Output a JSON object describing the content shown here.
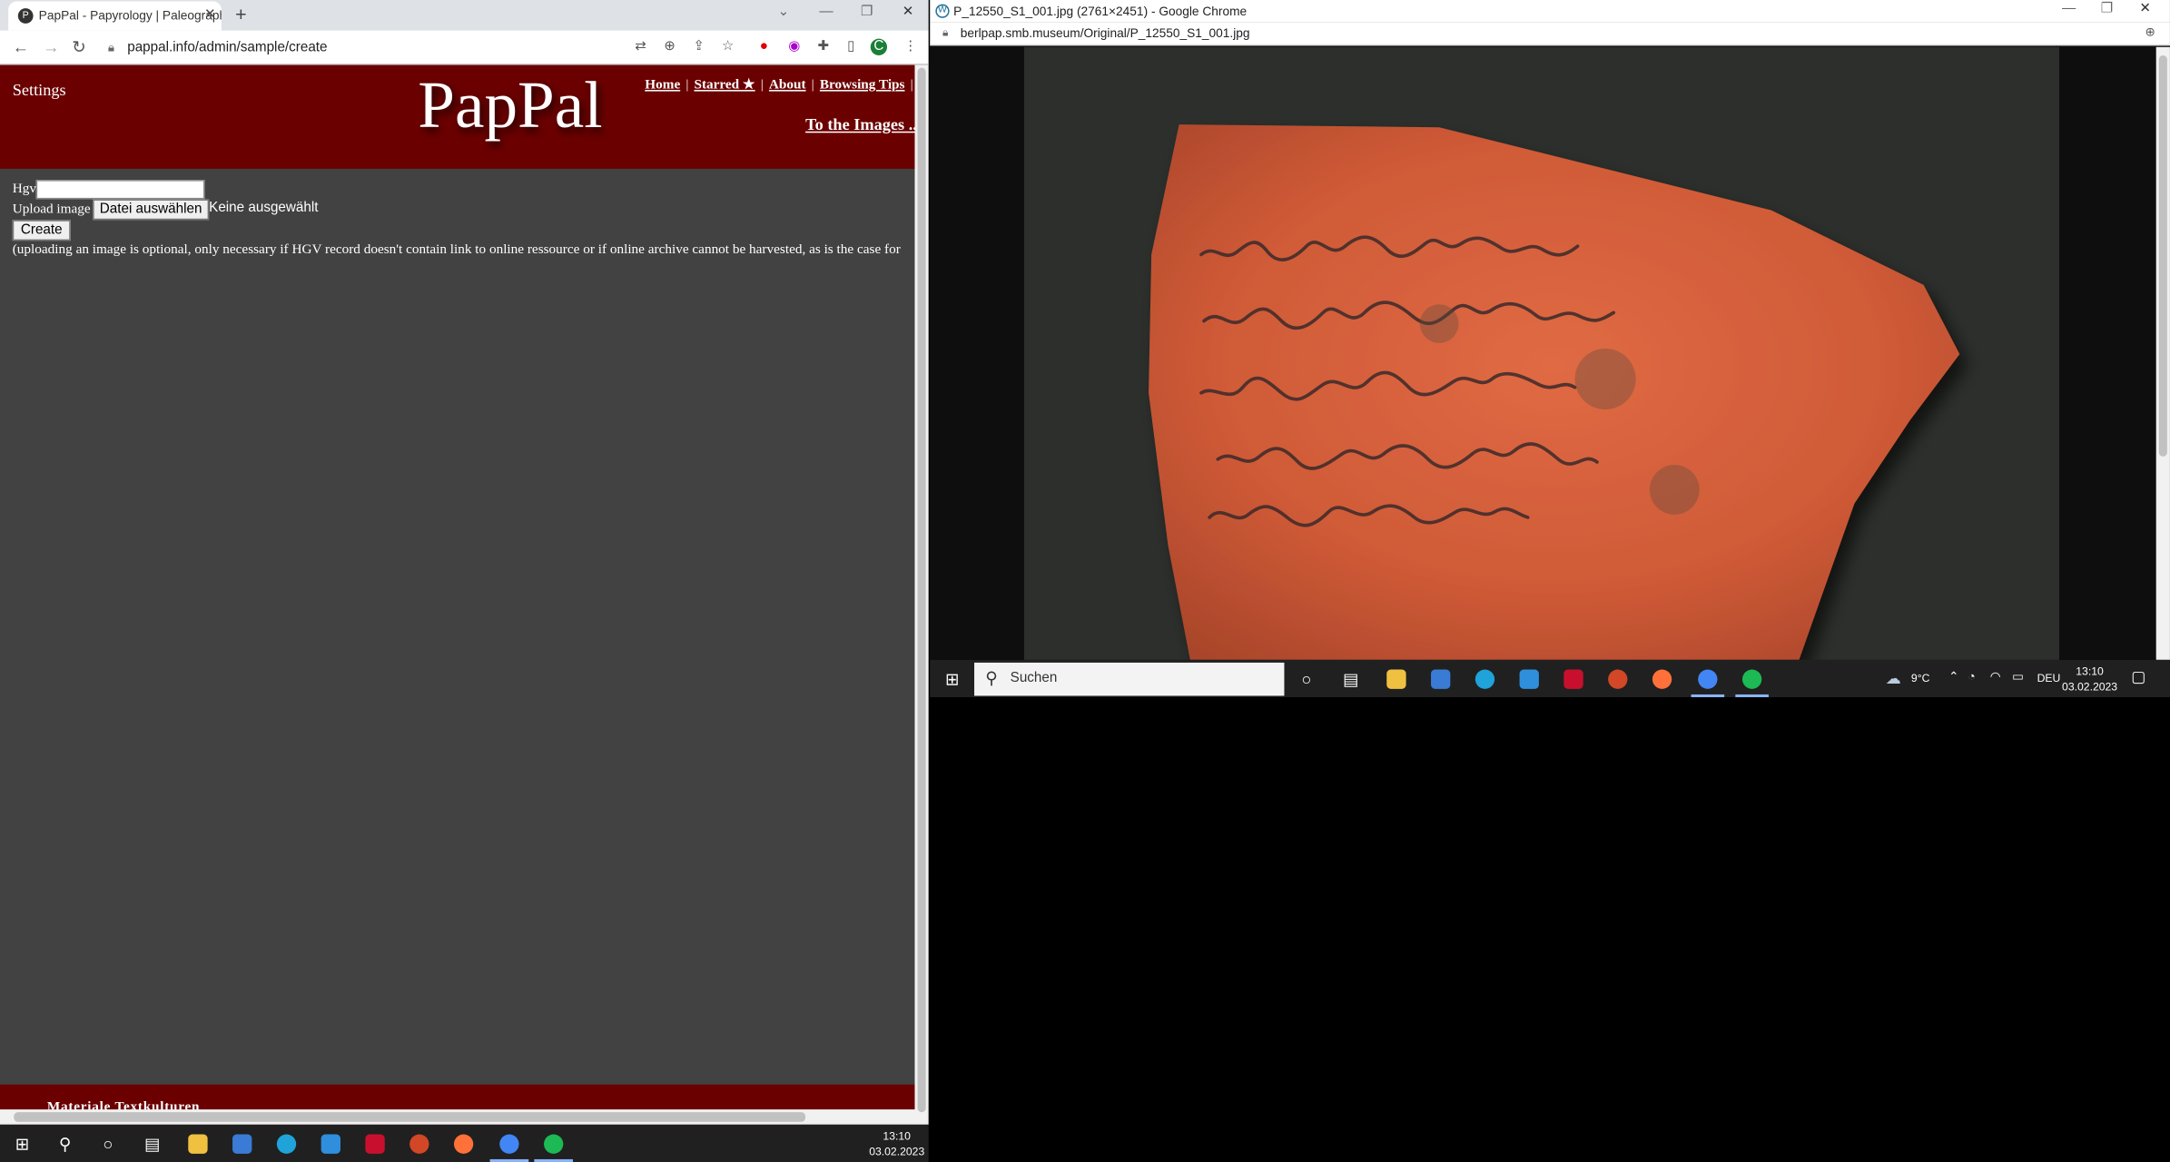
{
  "left_browser": {
    "tab_title": "PapPal - Papyrology | Paleograph",
    "url": "pappal.info/admin/sample/create"
  },
  "pappal": {
    "settings": "Settings",
    "logo": "PapPal",
    "nav": [
      "Home",
      "Starred ★",
      "About",
      "Browsing Tips"
    ],
    "to_images": "To the Images ...",
    "form": {
      "hgv_label": "Hgv",
      "hgv_value": "",
      "upload_label": "Upload image",
      "file_button": "Datei auswählen",
      "file_status": "Keine ausgewählt",
      "create_button": "Create",
      "note": "(uploading an image is optional, only necessary if HGV record doesn't contain link to online ressource or if online archive cannot be harvested, as is the case for"
    },
    "footer": "Materiale Textkulturen"
  },
  "right_browser": {
    "window_title": "P_12550_S1_001.jpg (2761×2451) - Google Chrome",
    "url": "berlpap.smb.museum/Original/P_12550_S1_001.jpg"
  },
  "taskbar_right": {
    "search_placeholder": "Suchen",
    "weather": "9°C",
    "language": "DEU",
    "time": "13:10",
    "date": "03.02.2023"
  },
  "taskbar_bottom": {
    "time": "13:10",
    "date": "03.02.2023"
  },
  "colors": {
    "pappal_header": "#6b0000",
    "page_bg": "#424242",
    "taskbar": "#202020"
  }
}
